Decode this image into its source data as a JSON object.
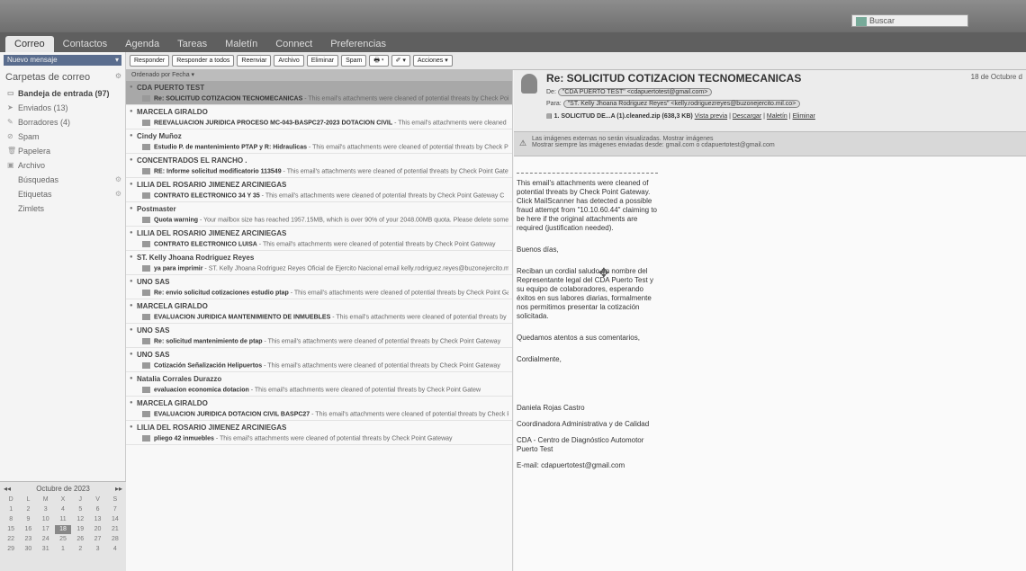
{
  "top": {
    "search_placeholder": "Buscar"
  },
  "tabs": [
    "Correo",
    "Contactos",
    "Agenda",
    "Tareas",
    "Maletín",
    "Connect",
    "Preferencias"
  ],
  "sidebar": {
    "new_message": "Nuevo mensaje",
    "folders_title": "Carpetas de correo",
    "folders": [
      {
        "label": "Bandeja de entrada (97)",
        "bold": true
      },
      {
        "label": "Enviados (13)",
        "bold": false
      },
      {
        "label": "Borradores (4)",
        "bold": false
      },
      {
        "label": "Spam",
        "bold": false
      },
      {
        "label": "Papelera",
        "bold": false
      }
    ],
    "sections": [
      "Archivo",
      "Búsquedas",
      "Etiquetas",
      "Zimlets"
    ],
    "calendar": {
      "title": "Octubre de 2023",
      "weekdays": [
        "D",
        "L",
        "M",
        "X",
        "J",
        "V",
        "S"
      ],
      "days": [
        "1",
        "2",
        "3",
        "4",
        "5",
        "6",
        "7",
        "8",
        "9",
        "10",
        "11",
        "12",
        "13",
        "14",
        "15",
        "16",
        "17",
        "18",
        "19",
        "20",
        "21",
        "22",
        "23",
        "24",
        "25",
        "26",
        "27",
        "28",
        "29",
        "30",
        "31",
        "1",
        "2",
        "3",
        "4"
      ],
      "today": "18"
    }
  },
  "toolbar": [
    "Responder",
    "Responder a todos",
    "Reenviar",
    "Archivo",
    "Eliminar",
    "Spam",
    "Acciones"
  ],
  "list": {
    "sort_label": "Ordenado por Fecha",
    "messages": [
      {
        "sender": "CDA PUERTO TEST",
        "subject": "Re: SOLICITUD COTIZACION TECNOMECANICAS",
        "fragment": " - This email's attachments were cleaned of potential threats by Check Point",
        "selected": true
      },
      {
        "sender": "MARCELA GIRALDO",
        "subject": "REEVALUACION JURIDICA PROCESO MC-043-BASPC27-2023 DOTACION CIVIL",
        "fragment": " - This email's attachments were cleaned of poter",
        "selected": false
      },
      {
        "sender": "Cindy Muñoz",
        "subject": "Estudio P. de mantenimiento PTAP y R: Hidraulicas",
        "fragment": " - This email's attachments were cleaned of potential threats by Check Point",
        "selected": false
      },
      {
        "sender": "CONCENTRADOS EL RANCHO .",
        "subject": "RE: Informe solicitud modificatorio 113549",
        "fragment": " - This email's attachments were cleaned of potential threats by Check Point Gatewa",
        "selected": false
      },
      {
        "sender": "LILIA DEL ROSARIO JIMENEZ ARCINIEGAS",
        "subject": "CONTRATO ELECTRONICO 34 Y 35",
        "fragment": " - This email's attachments were cleaned of potential threats by Check Point Gateway C",
        "selected": false
      },
      {
        "sender": "Postmaster",
        "subject": "Quota warning",
        "fragment": " - Your mailbox size has reached 1957.15MB, which is over 90% of your 2048.00MB quota. Please delete some",
        "selected": false
      },
      {
        "sender": "LILIA DEL ROSARIO JIMENEZ ARCINIEGAS",
        "subject": "CONTRATO ELECTRONICO LUISA",
        "fragment": " - This email's attachments were cleaned of potential threats by Check Point Gateway",
        "selected": false
      },
      {
        "sender": "ST. Kelly Jhoana Rodriguez Reyes",
        "subject": "ya para imprimir",
        "fragment": " - ST. Kelly Jhoana Rodriguez Reyes Oficial de Ejercito Nacional email kelly.rodriguez.reyes@buzonejercito.mil.co",
        "selected": false
      },
      {
        "sender": "UNO SAS",
        "subject": "Re: envio solicitud cotizaciones estudio ptap",
        "fragment": " - This email's attachments were cleaned of potential threats by Check Point Gat",
        "selected": false
      },
      {
        "sender": "MARCELA GIRALDO",
        "subject": "EVALUACION JURIDICA MANTENIMIENTO DE INMUEBLES",
        "fragment": " - This email's attachments were cleaned of potential threats by Check Point",
        "selected": false
      },
      {
        "sender": "UNO SAS",
        "subject": "Re: solicitud mantenimiento de ptap",
        "fragment": " - This email's attachments were cleaned of potential threats by Check Point Gateway",
        "selected": false
      },
      {
        "sender": "UNO SAS",
        "subject": "Cotización Señalización Helipuertos",
        "fragment": " - This email's attachments were cleaned of potential threats by Check Point Gateway",
        "selected": false
      },
      {
        "sender": "Natalia Corrales Durazzo",
        "subject": "evaluacion economica dotacion",
        "fragment": " - This email's attachments were cleaned of potential threats by Check Point Gatew",
        "selected": false
      },
      {
        "sender": "MARCELA GIRALDO",
        "subject": "EVALUACIÓN JURÍDICA DOTACIÓN CIVIL BASPC27",
        "fragment": " - This email's attachments were cleaned of potential threats by Check Point",
        "selected": false
      },
      {
        "sender": "LILIA DEL ROSARIO JIMENEZ ARCINIEGAS",
        "subject": "pliego 42 inmuebles",
        "fragment": " - This email's attachments were cleaned of potential threats by Check Point Gateway",
        "selected": false
      }
    ]
  },
  "reading": {
    "subject": "Re: SOLICITUD COTIZACION TECNOMECANICAS",
    "date": "18 de Octubre d",
    "from_label": "De:",
    "from": "\"CDA PUERTO TEST\" <cdapuertotest@gmail.com>",
    "to_label": "Para:",
    "to": "\"ST. Kelly Jhoana Rodriguez Reyes\" <kelly.rodriguezreyes@buzonejercito.mil.co>",
    "attachment": "1. SOLICITUD DE...A (1).cleaned.zip (638,3 KB)",
    "attachment_links": [
      "Vista previa",
      "Descargar",
      "Maletín",
      "Eliminar"
    ],
    "warning_line1": "Las imágenes externas no serán visualizadas. Mostrar imágenes",
    "warning_line2": "Mostrar siempre las imágenes enviadas desde: gmail.com o cdapuertotest@gmail.com",
    "body": [
      "This email's attachments were cleaned of potential threats by Check Point Gateway. Click MailScanner has detected a possible fraud attempt from \"10.10.60.44\" claiming to be here if the original attachments are required (justification needed).",
      "Buenos días,",
      "Reciban un cordial saludo en nombre del Representante legal del CDA Puerto Test y su equipo de colaboradores, esperando éxitos en sus labores diarias, formalmente nos permitimos presentar la cotización solicitada.",
      "Quedamos atentos a sus comentarios,",
      "Cordialmente,",
      "Daniela Rojas Castro",
      "Coordinadora Administrativa y de Calidad",
      "CDA - Centro de Diagnóstico Automotor Puerto Test",
      "E-mail: cdapuertotest@gmail.com"
    ]
  }
}
